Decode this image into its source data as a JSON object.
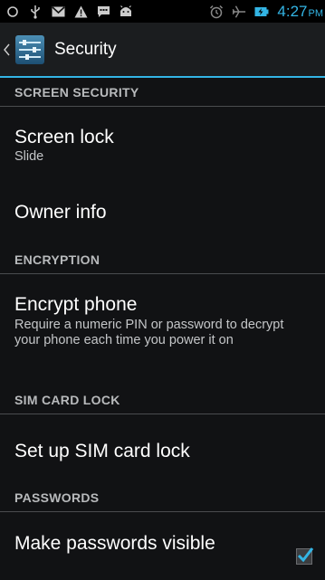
{
  "status_bar": {
    "icons": [
      "circle-outline-icon",
      "usb-icon",
      "gmail-icon",
      "warning-icon",
      "message-icon",
      "android-debug-icon",
      "alarm-icon",
      "airplane-mode-icon",
      "battery-charging-icon"
    ],
    "time": "4:27",
    "ampm": "PM",
    "accent_color": "#33b5e5"
  },
  "action_bar": {
    "title": "Security",
    "icon": "settings-sliders-icon"
  },
  "sections": {
    "screen_security": {
      "header": "SCREEN SECURITY",
      "screen_lock": {
        "title": "Screen lock",
        "summary": "Slide"
      },
      "owner_info": {
        "title": "Owner info"
      }
    },
    "encryption": {
      "header": "ENCRYPTION",
      "encrypt_phone": {
        "title": "Encrypt phone",
        "summary": "Require a numeric PIN or password to decrypt your phone each time you power it on"
      }
    },
    "sim_card_lock": {
      "header": "SIM CARD LOCK",
      "setup": {
        "title": "Set up SIM card lock"
      }
    },
    "passwords": {
      "header": "PASSWORDS",
      "make_visible": {
        "title": "Make passwords visible",
        "checked": true
      }
    }
  }
}
